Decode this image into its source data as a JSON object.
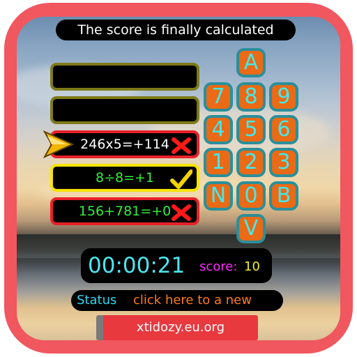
{
  "header": {
    "message": "The score is finally calculated"
  },
  "answers": [
    {
      "text": "",
      "state": "empty"
    },
    {
      "text": "",
      "state": "empty"
    },
    {
      "text": "246x5=+114",
      "state": "wrong"
    },
    {
      "text": "8÷8=+1",
      "state": "correct"
    },
    {
      "text": "156+781=+0",
      "state": "wrong"
    }
  ],
  "keypad": {
    "keys": [
      "A",
      "7",
      "8",
      "9",
      "4",
      "5",
      "6",
      "1",
      "2",
      "3",
      "N",
      "0",
      "B",
      "V"
    ]
  },
  "timer": {
    "time": "00:00:21",
    "score_label": "score:",
    "score_value": "10"
  },
  "status": {
    "label": "Status",
    "link": "click here to a new"
  },
  "footer": {
    "site": "xtidozy.eu.org"
  },
  "colors": {
    "frame": "#f0575f",
    "key_fill": "#ea6a15",
    "key_border": "#2b8f9a",
    "key_text": "#43e8ee",
    "answer_text": "#32f03a",
    "wrong": "#e8212a",
    "correct": "#f6e400"
  },
  "icons": {
    "pointer": "arrow-pointer-icon",
    "wrong": "red-cross-icon",
    "correct": "yellow-check-icon"
  }
}
